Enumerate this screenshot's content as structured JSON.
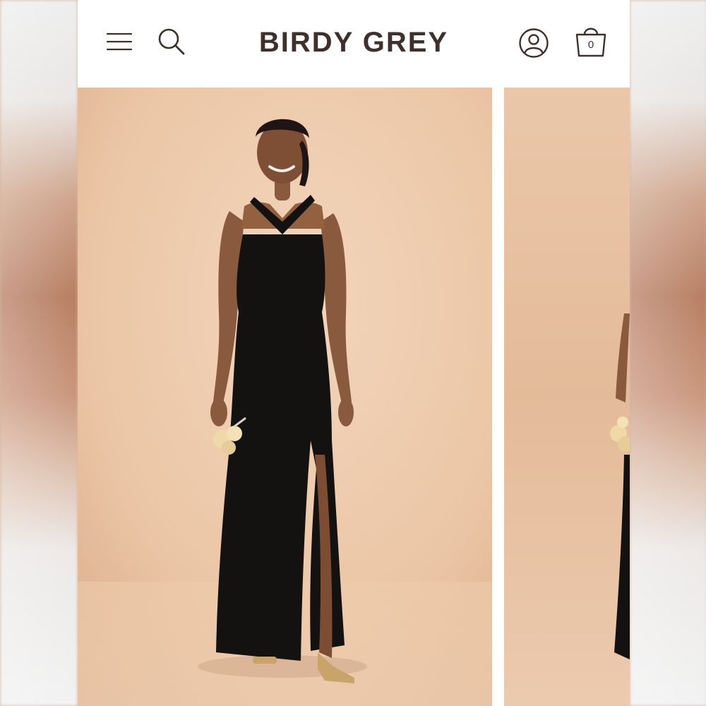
{
  "header": {
    "brand": "BIRDY GREY",
    "cart_count": "0",
    "icons": {
      "menu": "hamburger-menu-icon",
      "search": "search-icon",
      "account": "account-icon",
      "cart": "shopping-bag-icon"
    }
  },
  "gallery": {
    "slides": [
      {
        "label": "model-wearing-black-halter-gown-with-slit"
      },
      {
        "label": "model-side-view-partial"
      }
    ]
  },
  "colors": {
    "brand_text": "#3f302c",
    "backdrop": "#ecc8aa",
    "dress": "#141111",
    "skin": "#8a5a3f",
    "bouquet": "#efd9a8"
  }
}
